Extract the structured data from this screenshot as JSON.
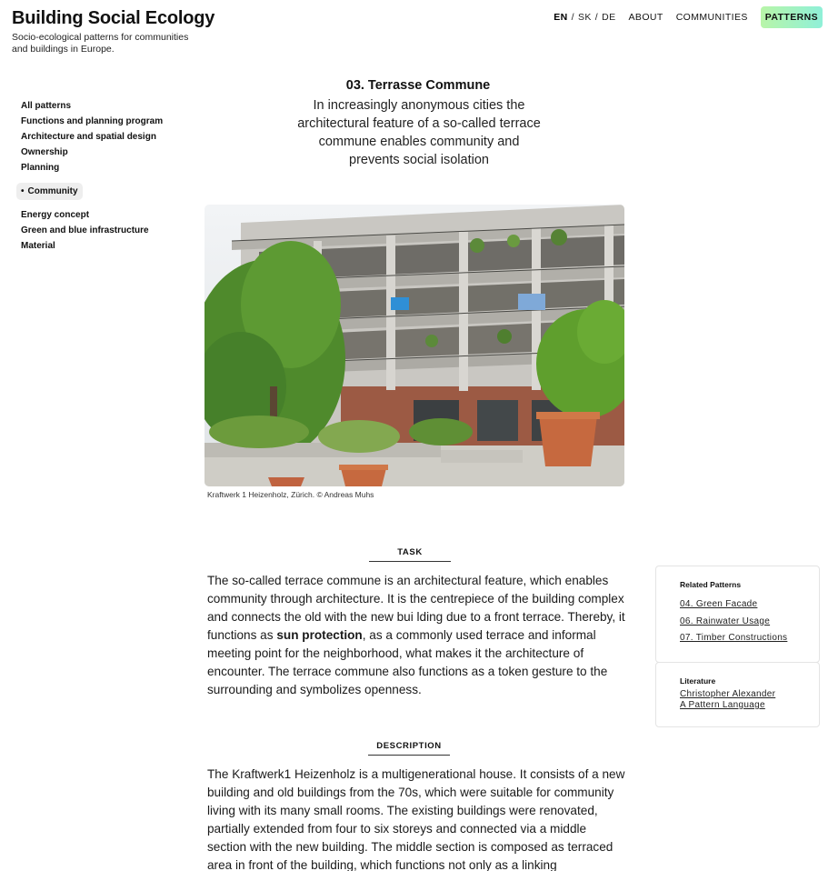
{
  "site": {
    "title": "Building Social Ecology",
    "subtitle": "Socio-ecological patterns for communities and buildings in Europe."
  },
  "nav": {
    "languages": [
      "EN",
      "SK",
      "DE"
    ],
    "active_language": "EN",
    "links": [
      "ABOUT",
      "COMMUNITIES",
      "PATTERNS"
    ],
    "active_link": "PATTERNS",
    "highlight_colors": [
      "#b8f5a8",
      "#8ff0d8"
    ]
  },
  "sidebar": {
    "items": [
      "All patterns",
      "Functions and planning program",
      "Architecture and spatial design",
      "Ownership",
      "Planning",
      "Community",
      "Energy concept",
      "Green and blue infrastructure",
      "Material"
    ],
    "active_item": "Community"
  },
  "pattern": {
    "title": "03. Terrasse Commune",
    "lead": "In increasingly anonymous cities the architectural feature of a so-called terrace commune enables community and prevents social isolation",
    "image_caption": "Kraftwerk 1 Heizenholz, Zürich. © Andreas Muhs"
  },
  "task": {
    "heading": "TASK",
    "text_before": "The so-called terrace commune is an architectural feature, which enables community through architecture. It is the centrepiece of the building complex and connects the old with the new bui  lding due to a front terrace. Thereby, it functions as ",
    "text_bold": "sun protection",
    "text_after": ", as a commonly used terrace and informal meeting point for the neighborhood, what makes it the architecture of encounter. The terrace commune also functions as a token gesture to the surrounding and symbolizes openness."
  },
  "description": {
    "heading": "DESCRIPTION",
    "text": "The Kraftwerk1 Heizenholz is a multigenerational house. It consists of a new building and old buildings from the 70s, which were suitable for community living with its many small rooms. The existing buildings were renovated, partially extended from four to six storeys and connected via a middle section with the new building. The middle section is composed as terraced area in front of the building, which functions not only as a linking"
  },
  "related": {
    "title": "Related Patterns",
    "links": [
      "04. Green Facade",
      "06. Rainwater Usage",
      "07. Timber Constructions"
    ]
  },
  "literature": {
    "title": "Literature",
    "author": "Christopher Alexander",
    "book": "A Pattern Language"
  }
}
